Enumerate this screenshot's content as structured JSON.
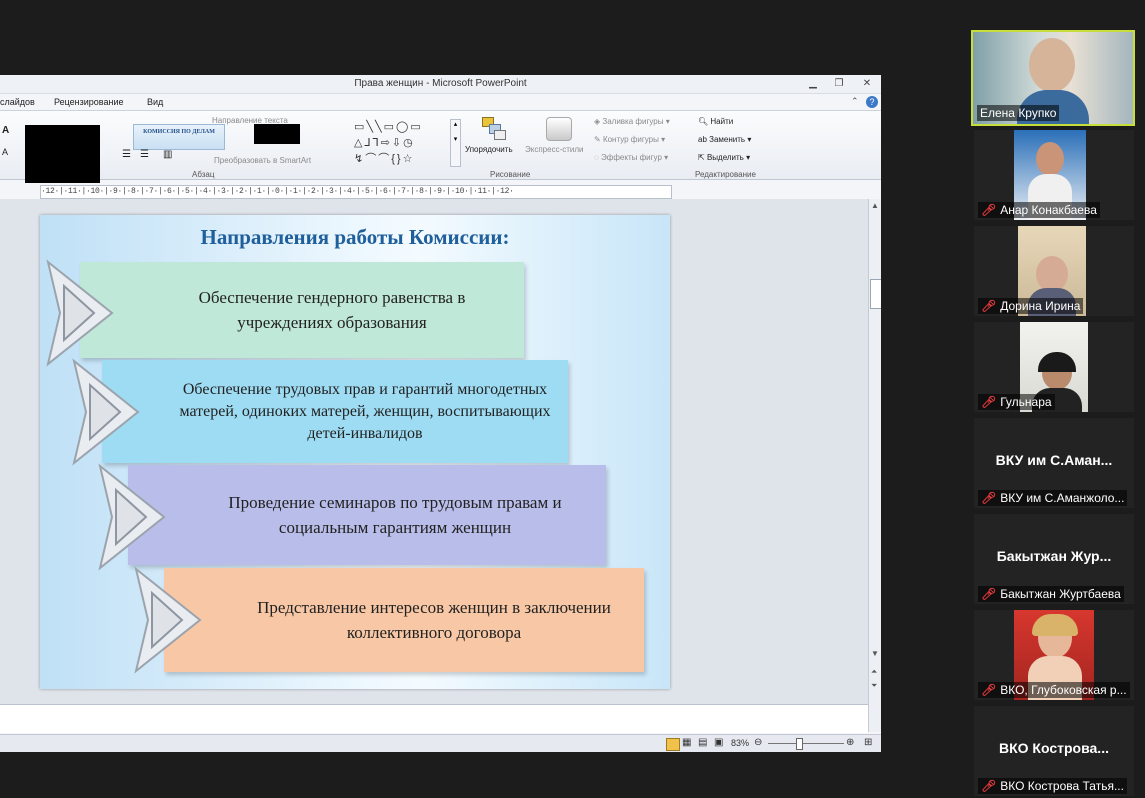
{
  "window": {
    "title": "Права женщин  -  Microsoft PowerPoint"
  },
  "menu": [
    "слайдов",
    "Рецензирование",
    "Вид"
  ],
  "ribbon": {
    "paragraph_group": "Абзац",
    "drawing_group": "Рисование",
    "editing_group": "Редактирование",
    "text_direction": "Направление текста",
    "convert_smartart": "Преобразовать в SmartArt",
    "arrange": "Упорядочить",
    "quick_styles": "Экспресс-стили",
    "shape_fill": "Заливка фигуры",
    "shape_outline": "Контур фигуры",
    "shape_effects": "Эффекты фигур",
    "find": "Найти",
    "replace": "Заменить",
    "select": "Выделить",
    "thumbnail_text": "КОМИССИЯ ПО ДЕЛАМ"
  },
  "ruler": "·12·|·11·|·10·|·9·|·8·|·7·|·6·|·5·|·4·|·3·|·2·|·1·|·0·|·1·|·2·|·3·|·4·|·5·|·6·|·7·|·8·|·9·|·10·|·11·|·12·",
  "slide": {
    "title": "Направления работы Комиссии:",
    "items": [
      {
        "text": "Обеспечение гендерного равенства в учреждениях образования",
        "color": "#bfe8d9"
      },
      {
        "text": "Обеспечение трудовых прав и гарантий многодетных матерей, одиноких матерей, женщин, воспитывающих детей-инвалидов",
        "color": "#9edcf3"
      },
      {
        "text": "Проведение семинаров по трудовым правам и социальным гарантиям женщин",
        "color": "#b9bde9"
      },
      {
        "text": "Представление интересов женщин в заключении коллективного договора",
        "color": "#f8c8a6"
      }
    ]
  },
  "status": {
    "zoom": "83%",
    "zoom_level": 0.83
  },
  "participants": [
    {
      "label": "Елена Крупко",
      "active": true,
      "muted": false,
      "photo": true
    },
    {
      "label": "Анар Конакбаева",
      "muted": true,
      "photo": true
    },
    {
      "label": "Дорина Ирина",
      "muted": true,
      "photo": true
    },
    {
      "label": "Гульнара",
      "muted": true,
      "photo": true
    },
    {
      "label": "ВКУ им С.Аманжоло...",
      "big": "ВКУ им С.Аман...",
      "muted": true,
      "photo": false
    },
    {
      "label": "Бакытжан Журтбаева",
      "big": "Бакытжан  Жур...",
      "muted": true,
      "photo": false
    },
    {
      "label": "ВКО, Глубоковская р...",
      "muted": true,
      "photo": true
    },
    {
      "label": "ВКО Кострова Татья...",
      "big": "ВКО  Кострова...",
      "muted": true,
      "photo": false
    }
  ]
}
